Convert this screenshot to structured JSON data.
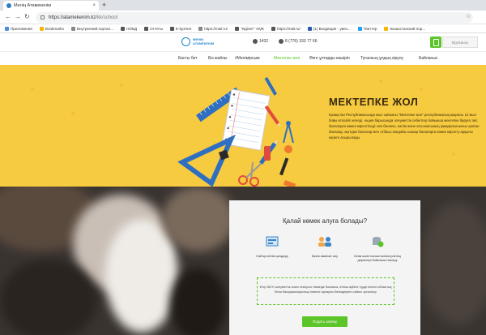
{
  "browser": {
    "tab_title": "Менің Атамекенім",
    "tab_close": "×",
    "new_tab": "+",
    "url_domain": "https://atamekenim.kz",
    "url_path": "/kk/school",
    "bookmarks": [
      {
        "label": "Приложения",
        "icon": "apps-icon",
        "color": "#4a8bdc"
      },
      {
        "label": "Bookmarks",
        "icon": "star-icon",
        "color": "#f4b400"
      },
      {
        "label": "Внутренний портал...",
        "icon": "globe-icon",
        "color": "#888888"
      },
      {
        "label": "НОБД",
        "icon": "globe-icon",
        "color": "#555555"
      },
      {
        "label": "Отчеты",
        "icon": "globe-icon",
        "color": "#555555"
      },
      {
        "label": "E-kyzmet",
        "icon": "globe-icon",
        "color": "#555555"
      },
      {
        "label": "https://mail.ru/",
        "icon": "page-icon",
        "color": "#888888"
      },
      {
        "label": "\"Әділет\" АҚЖ",
        "icon": "globe-icon",
        "color": "#555555"
      },
      {
        "label": "https://mail.ru/",
        "icon": "globe-icon",
        "color": "#555555"
      },
      {
        "label": "(1) Входящие - увез...",
        "icon": "mail-icon",
        "color": "#2a5db0"
      },
      {
        "label": "Твиттер",
        "icon": "twitter-icon",
        "color": "#1da1f2"
      },
      {
        "label": "Казахстанский пор...",
        "icon": "star-icon",
        "color": "#f4b400"
      }
    ]
  },
  "header": {
    "logo_line1": "МЕНІҢ",
    "logo_line2": "АТАМЕКЕНІМ",
    "phone": "1432",
    "whatsapp": "8 (776) 333 77 66",
    "login_label": "Кіру/Шығу"
  },
  "nav": [
    "Басты бет",
    "Біз жайлы",
    "#Менімірсым",
    "Мектепке жол",
    "Өзге ұлтарды көшіріп",
    "Туғанның ұлдың кірулу",
    "Байланыс"
  ],
  "nav_active_index": 3,
  "hero": {
    "title": "МЕКТЕПКЕ ЖОЛ",
    "text": "Қазақстан Республикасында жыл сайынғы \"Мектепке жол\" республикалық акциясы 12 жыл бойы өткізіліп келеді. Акция барысында әлеуметтік себептер бойынша мектепке баруға тиіс балаларға көмек көрсетіледі: көп балалы, жетім және ата-анасының қамқорлығынсыз қалған балалар, мүгедек балалар мен отбасы жағдайы нашар балаларға көмек көрсету арқылы жүзеге асырылады."
  },
  "help": {
    "title": "Қалай көмек алуға болады?",
    "options": [
      {
        "label": "Сайтқа өтінім қалдыру",
        "icon": "form-icon"
      },
      {
        "label": "Көзек көмекке алу",
        "icon": "people-icon"
      },
      {
        "label": "Білім және ғылым министрлігінің деректері бойынша тексеру",
        "icon": "database-check-icon"
      }
    ],
    "notice": "Егер ЖСН әлеуметтік алып тіпкерсіз тізімінде болмаса, өтініш жүйесі түрде келесі облыстық білім басқармаларының немесе арнаулы бөлімдеріне сәйкес орналасу",
    "submit": "Подать заявку"
  },
  "colors": {
    "accent_green": "#5cc52a",
    "hero_yellow": "#f7cb3f",
    "brand_blue": "#1e86c8"
  }
}
